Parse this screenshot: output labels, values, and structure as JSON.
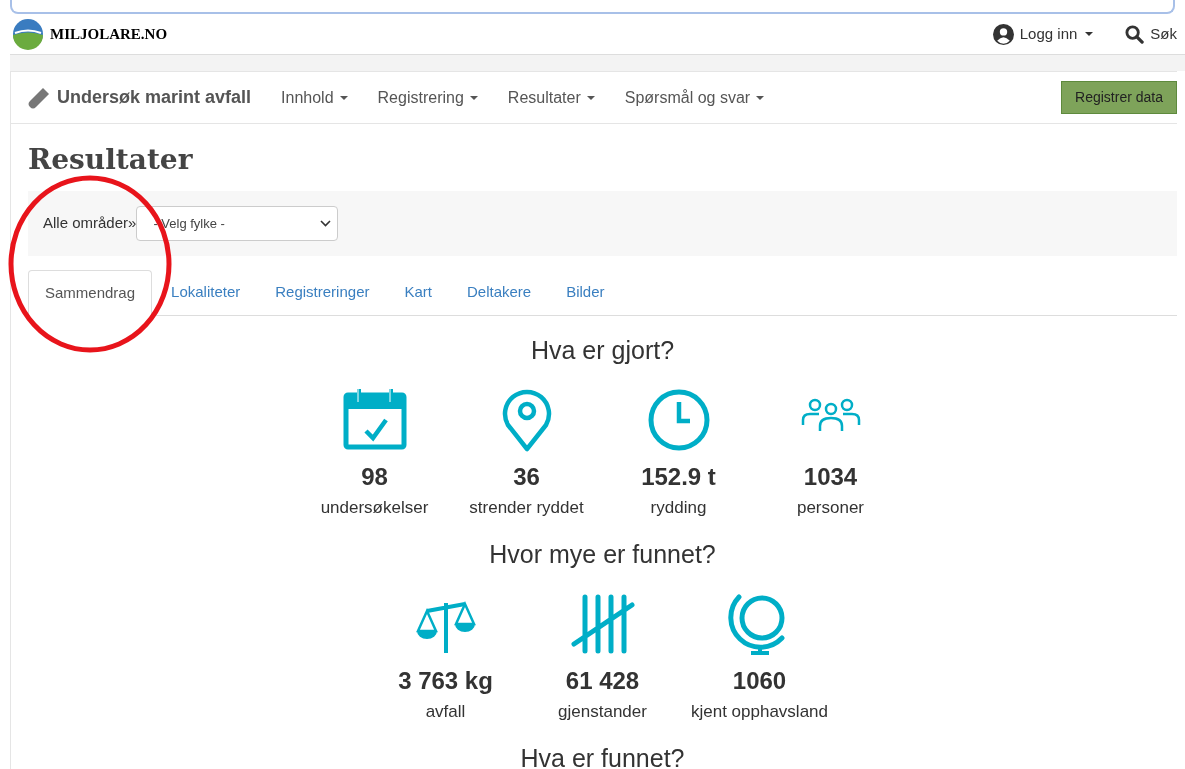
{
  "site": {
    "name": "MILJOLARE.NO",
    "login": "Logg inn",
    "search": "Søk"
  },
  "navbar": {
    "brand": "Undersøk marint avfall",
    "menus": [
      "Innhold",
      "Registrering",
      "Resultater",
      "Spørsmål og svar"
    ],
    "action": "Registrer data"
  },
  "page_title": "Resultater",
  "filter": {
    "label": "Alle områder»",
    "select": "- Velg fylke -"
  },
  "tabs": [
    {
      "label": "Sammendrag",
      "selected": true,
      "circled": true
    },
    {
      "label": "Lokaliteter",
      "selected": false,
      "circled": false
    },
    {
      "label": "Registreringer",
      "selected": false,
      "circled": false
    },
    {
      "label": "Kart",
      "selected": false,
      "circled": false
    },
    {
      "label": "Deltakere",
      "selected": false,
      "circled": false
    },
    {
      "label": "Bilder",
      "selected": false,
      "circled": false
    }
  ],
  "sections": [
    {
      "heading": "Hva er gjort?",
      "stats": [
        {
          "kind": "calendar",
          "value": "98",
          "label": "undersøkelser"
        },
        {
          "kind": "pin",
          "value": "36",
          "label": "strender ryddet"
        },
        {
          "kind": "clock",
          "value": "152.9 t",
          "label": "rydding"
        },
        {
          "kind": "people",
          "value": "1034",
          "label": "personer"
        }
      ]
    },
    {
      "heading": "Hvor mye er funnet?",
      "stats": [
        {
          "kind": "scale",
          "value": "3 763 kg",
          "label": "avfall"
        },
        {
          "kind": "tally",
          "value": "61 428",
          "label": "gjenstander"
        },
        {
          "kind": "globe",
          "value": "1060",
          "label": "kjent opphavsland"
        }
      ]
    },
    {
      "heading": "Hva er funnet?"
    }
  ]
}
